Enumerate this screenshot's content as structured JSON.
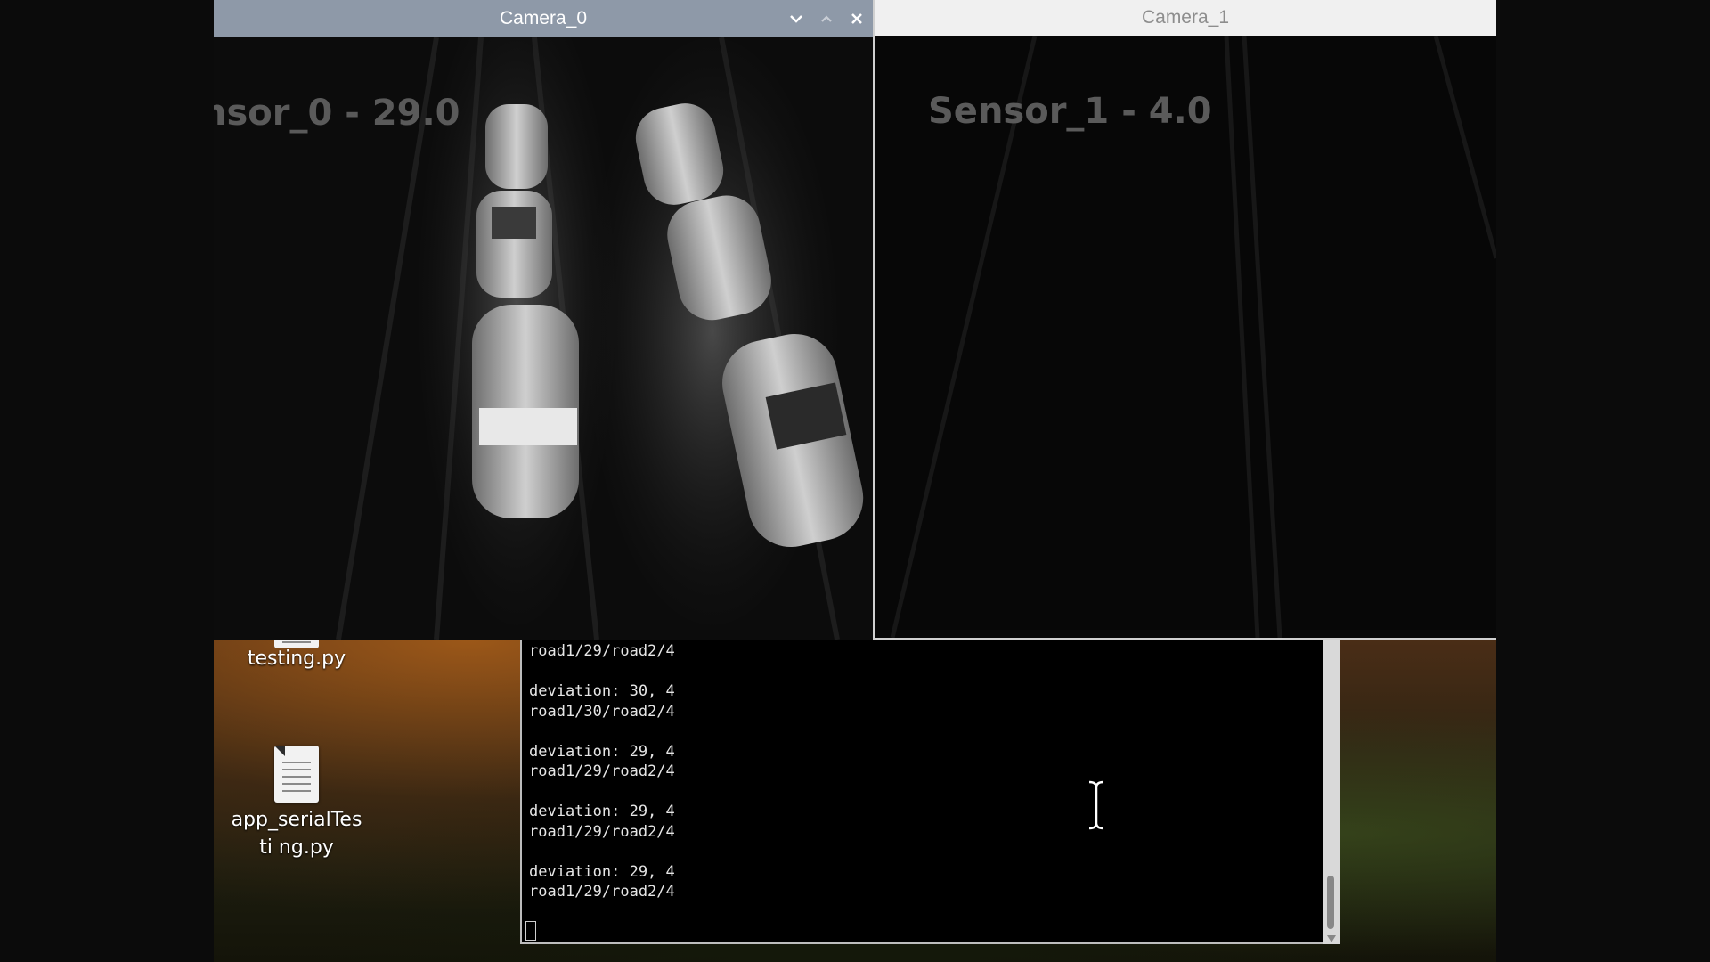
{
  "cameras": [
    {
      "title": "Camera_0",
      "overlay": "nsor_0 - 29.0"
    },
    {
      "title": "Camera_1",
      "overlay": "Sensor_1 - 4.0"
    }
  ],
  "desktop_icons": [
    {
      "label": "testing.py",
      "icon": "document-icon"
    },
    {
      "label": "app_serialTesti ng.py",
      "icon": "document-icon"
    }
  ],
  "terminal": {
    "lines": "road1/29/road2/4\n\ndeviation: 30, 4\nroad1/30/road2/4\n\ndeviation: 29, 4\nroad1/29/road2/4\n\ndeviation: 29, 4\nroad1/29/road2/4\n\ndeviation: 29, 4\nroad1/29/road2/4"
  },
  "colors": {
    "active_titlebar": "#8e99a8",
    "inactive_titlebar": "#f0f0f0",
    "terminal_bg": "#000000"
  }
}
